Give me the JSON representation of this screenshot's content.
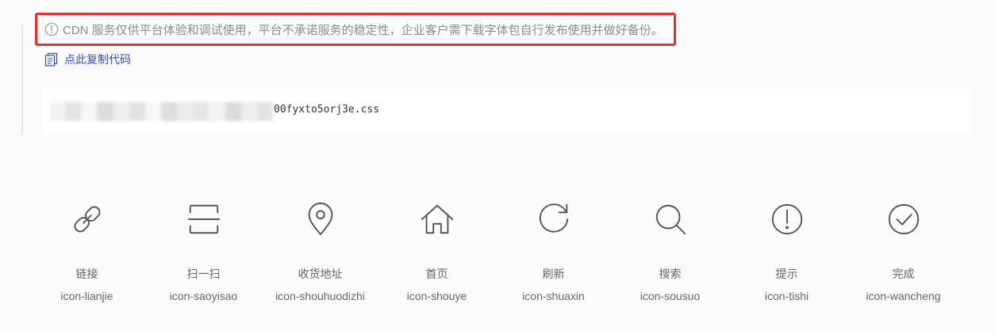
{
  "notice": {
    "text": "CDN 服务仅供平台体验和调试使用，平台不承诺服务的稳定性，企业客户需下载字体包自行发布使用并做好备份。",
    "highlight_color": "#e8312f"
  },
  "copy_link": {
    "label": "点此复制代码",
    "color": "#2d4fd6"
  },
  "code": {
    "visible_suffix": "00fyxto5orj3e.css"
  },
  "icons": [
    {
      "name": "链接",
      "code": "icon-lianjie",
      "icon": "link-icon"
    },
    {
      "name": "扫一扫",
      "code": "icon-saoyisao",
      "icon": "scan-icon"
    },
    {
      "name": "收货地址",
      "code": "icon-shouhuodizhi",
      "icon": "location-pin-icon"
    },
    {
      "name": "首页",
      "code": "icon-shouye",
      "icon": "home-icon"
    },
    {
      "name": "刷新",
      "code": "icon-shuaxin",
      "icon": "refresh-icon"
    },
    {
      "name": "搜索",
      "code": "icon-sousuo",
      "icon": "search-icon"
    },
    {
      "name": "提示",
      "code": "icon-tishi",
      "icon": "exclamation-circle-icon"
    },
    {
      "name": "完成",
      "code": "icon-wancheng",
      "icon": "check-circle-icon"
    }
  ]
}
